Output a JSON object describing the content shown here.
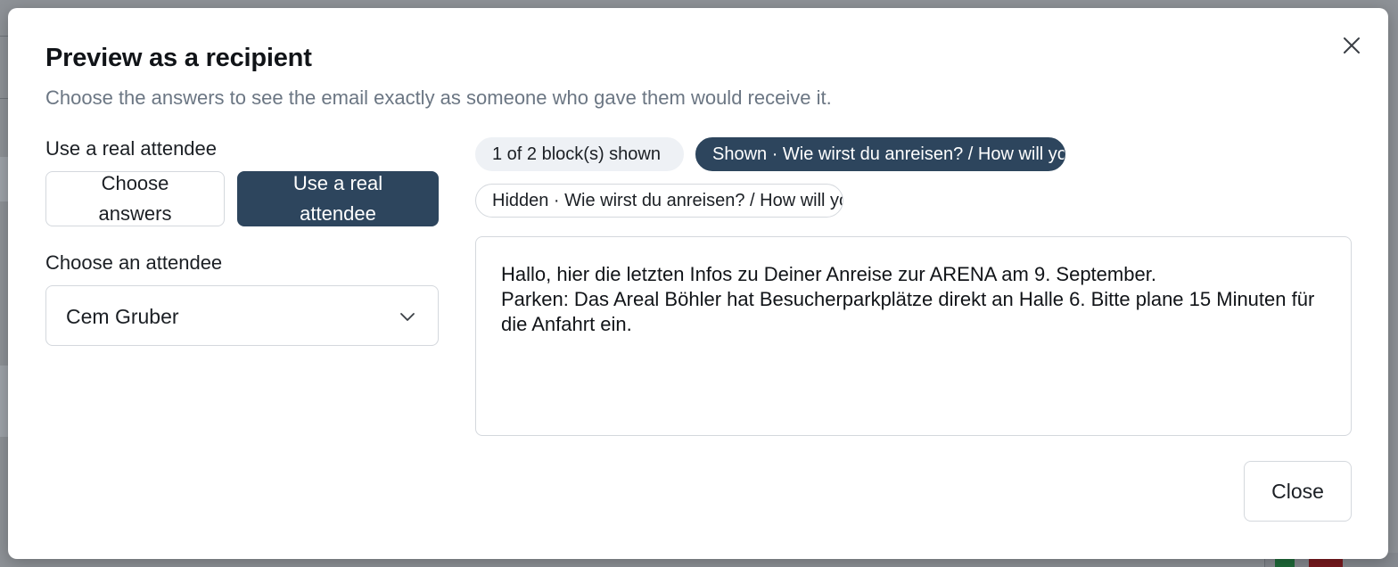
{
  "modal": {
    "title": "Preview as a recipient",
    "subtitle": "Choose the answers to see the email exactly as someone who gave them would receive it.",
    "mode_label": "Use a real attendee",
    "mode_options": {
      "choose_answers": "Choose answers",
      "use_real_attendee": "Use a real attendee"
    },
    "attendee_label": "Choose an attendee",
    "attendee_selected": "Cem Gruber",
    "blocks": {
      "count": "1 of 2 block(s) shown",
      "shown": "Shown · Wie wirst du anreisen? / How will you travel?",
      "hidden": "Hidden · Wie wirst du anreisen? / How will you travel?"
    },
    "preview_lines": [
      "Hallo, hier die letzten Infos zu Deiner Anreise zur ARENA am 9. September.",
      "Parken: Das Areal Böhler hat Besucherparkplätze direkt an Halle 6. Bitte plane 15 Minuten für die Anfahrt ein."
    ],
    "close_label": "Close"
  },
  "colors": {
    "accent": "#2d455d",
    "muted_text": "#6b7683",
    "chip_bg": "#eef1f5",
    "border": "#d4d8dd"
  },
  "icons": {
    "close": "close-icon",
    "dropdown": "chevron-down-icon"
  }
}
